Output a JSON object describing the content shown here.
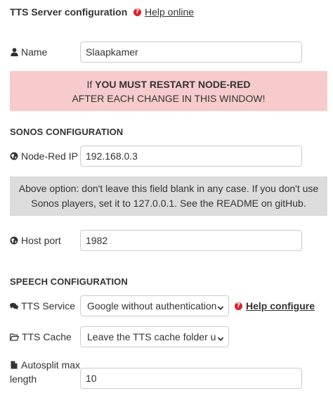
{
  "header": {
    "title": "TTS Server configuration",
    "help_label": "Help online"
  },
  "name_field": {
    "label": "Name",
    "value": "Slaapkamer"
  },
  "restart_banner": {
    "line1_prefix": "If ",
    "line1_bold": "YOU MUST RESTART NODE-RED",
    "line2": "AFTER EACH CHANGE IN THIS WINDOW!"
  },
  "sonos_section": {
    "heading": "SONOS CONFIGURATION",
    "node_red_ip": {
      "label": "Node-Red IP",
      "value": "192.168.0.3"
    },
    "note": {
      "line1": "Above option: don't leave this field blank in any case. If you don't use",
      "line2": "Sonos players, set it to 127.0.0.1. See the README on gitHub."
    },
    "host_port": {
      "label": "Host port",
      "value": "1982"
    }
  },
  "speech_section": {
    "heading": "SPEECH CONFIGURATION",
    "tts_service": {
      "label": "TTS Service",
      "selected": "Google without authentication",
      "help_label": "Help configure"
    },
    "tts_cache": {
      "label": "TTS Cache",
      "selected": "Leave the TTS cache folder u"
    },
    "autosplit": {
      "label_line1": "Autosplit max",
      "label_line2": "length",
      "value": "10"
    }
  },
  "icons": {
    "help": "question-circle-icon",
    "user": "user-icon",
    "globe": "globe-icon",
    "comments": "comments-icon",
    "folder": "folder-open-icon",
    "file": "file-icon",
    "chevron": "chevron-down-icon"
  },
  "colors": {
    "help_icon": "#d9232f",
    "warning_bg": "#f7cbcb",
    "note_bg": "#dcdcdc"
  }
}
